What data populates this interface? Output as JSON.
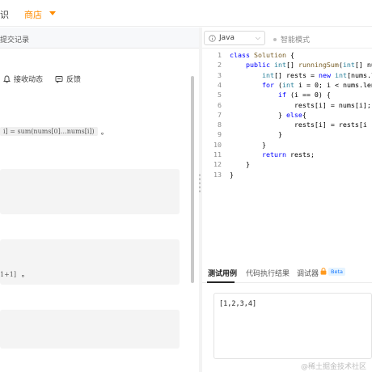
{
  "nav": {
    "partial_item": "识",
    "store_label": "商店"
  },
  "left": {
    "submissions_tab": "提交记录",
    "actions": [
      {
        "icon": "bell-icon",
        "label": "接收动态"
      },
      {
        "icon": "feedback-icon",
        "label": "反馈"
      }
    ],
    "formula_text": "i] = sum(nums[0]…nums[i])",
    "formula_punct": "。",
    "block3_text": "1+1]",
    "block3_punct": "。"
  },
  "editor": {
    "language": "Java",
    "smart_mode": "智能模式",
    "lines": [
      {
        "n": "1",
        "code": "class Solution {"
      },
      {
        "n": "2",
        "code": "    public int[] runningSum(int[] nu"
      },
      {
        "n": "3",
        "code": "        int[] rests = new int[nums.l"
      },
      {
        "n": "4",
        "code": "        for (int i = 0; i < nums.len"
      },
      {
        "n": "5",
        "code": "            if (i == 0) {"
      },
      {
        "n": "6",
        "code": "                rests[i] = nums[i];"
      },
      {
        "n": "7",
        "code": "            } else{"
      },
      {
        "n": "8",
        "code": "                rests[i] = rests[i"
      },
      {
        "n": "9",
        "code": "            }"
      },
      {
        "n": "10",
        "code": "        }"
      },
      {
        "n": "11",
        "code": "        return rests;"
      },
      {
        "n": "12",
        "code": "    }"
      },
      {
        "n": "13",
        "code": "}"
      }
    ]
  },
  "console": {
    "tabs": [
      "测试用例",
      "代码执行结果",
      "调试器"
    ],
    "beta": "Beta",
    "testcase_value": "[1,2,3,4]"
  },
  "watermark": "@稀土掘金技术社区",
  "colors": {
    "accent": "#ff8c00",
    "keyword": "#0000ff",
    "type": "#267f99",
    "beta": "#1677ff"
  }
}
